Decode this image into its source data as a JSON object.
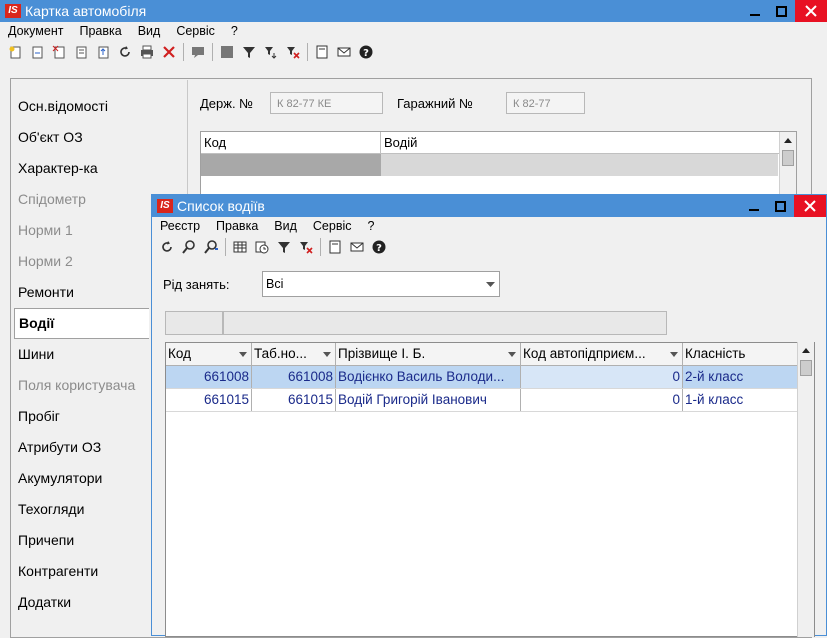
{
  "main_window": {
    "title": "Картка автомобіля",
    "menu": [
      "Документ",
      "Правка",
      "Вид",
      "Сервіс",
      "?"
    ],
    "fields": {
      "state_number_label": "Держ. №",
      "state_number_value": "К 82-77 КЕ",
      "garage_number_label": "Гаражний №",
      "garage_number_value": "К 82-77"
    },
    "top_grid": {
      "columns": [
        "Код",
        "Водій"
      ]
    },
    "sidebar": [
      {
        "label": "Осн.відомості",
        "state": "normal"
      },
      {
        "label": "Об'єкт ОЗ",
        "state": "normal"
      },
      {
        "label": "Характер-ка",
        "state": "normal"
      },
      {
        "label": "Спідометр",
        "state": "disabled"
      },
      {
        "label": "Норми 1",
        "state": "disabled"
      },
      {
        "label": "Норми 2",
        "state": "disabled"
      },
      {
        "label": "Ремонти",
        "state": "normal"
      },
      {
        "label": "Водії",
        "state": "active"
      },
      {
        "label": "Шини",
        "state": "normal"
      },
      {
        "label": "Поля користувача",
        "state": "disabled"
      },
      {
        "label": "Пробіг",
        "state": "normal"
      },
      {
        "label": "Атрибути ОЗ",
        "state": "normal"
      },
      {
        "label": "Акумулятори",
        "state": "normal"
      },
      {
        "label": "Техогляди",
        "state": "normal"
      },
      {
        "label": "Причепи",
        "state": "normal"
      },
      {
        "label": "Контрагенти",
        "state": "normal"
      },
      {
        "label": "Додатки",
        "state": "normal"
      }
    ]
  },
  "dialog": {
    "title": "Список водіїв",
    "menu": [
      "Реєстр",
      "Правка",
      "Вид",
      "Сервіс",
      "?"
    ],
    "filter_label": "Рід занять:",
    "filter_value": "Всі",
    "columns": [
      "Код",
      "Таб.но...",
      "Прізвище І. Б.",
      "Код автопідприєм...",
      "Класність"
    ],
    "rows": [
      [
        "661008",
        "661008",
        "Водієнко Василь Володи...",
        "0",
        "2-й класс"
      ],
      [
        "661015",
        "661015",
        "Водій Григорій Іванович",
        "0",
        "1-й класс"
      ]
    ],
    "selected_row": 0
  },
  "logo_text": "IS",
  "colors": {
    "title_bar": "#4a8fd6",
    "close_button": "#e81123",
    "selection": "#bcd6f2",
    "logo": "#d9261c"
  }
}
